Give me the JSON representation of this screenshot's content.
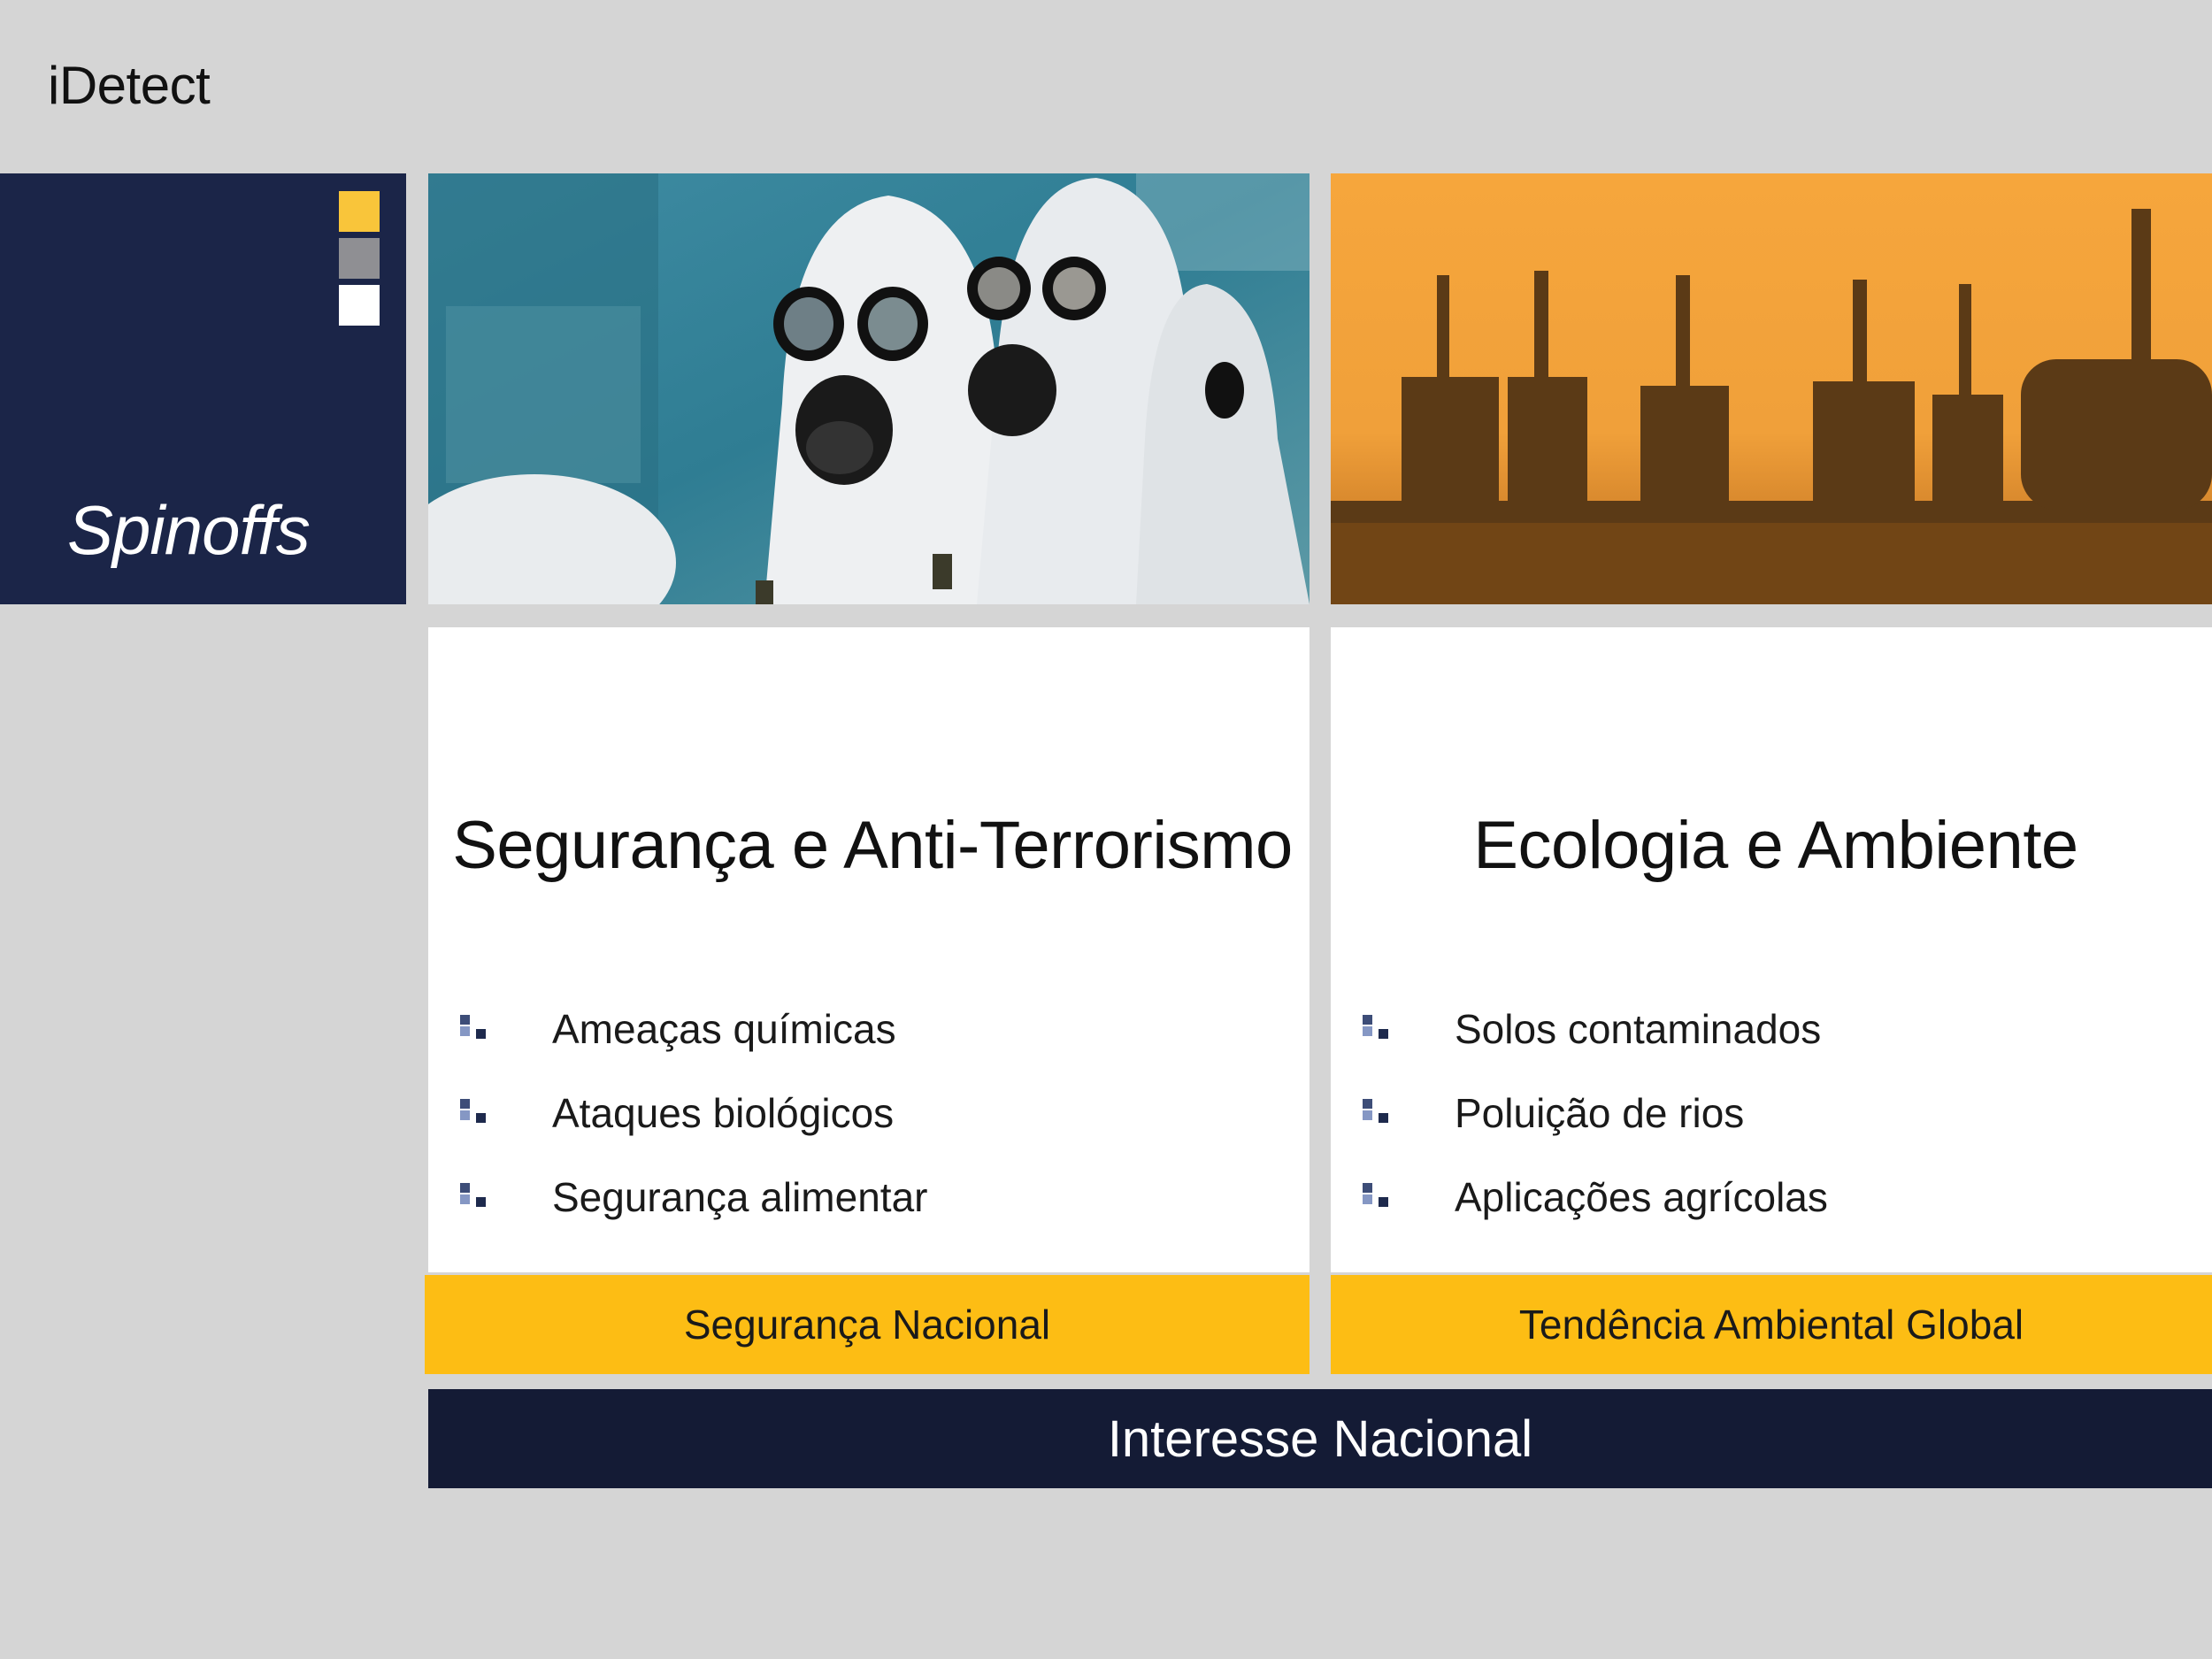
{
  "app": {
    "title": "iDetect"
  },
  "section": {
    "label": "Spinoffs"
  },
  "cards": [
    {
      "title": "Segurança e Anti-Terrorismo",
      "bullets": [
        "Ameaças químicas",
        "Ataques biológicos",
        "Segurança alimentar"
      ],
      "footer": "Segurança Nacional",
      "image": "hazmat-suits-gas-masks-photo"
    },
    {
      "title": "Ecologia e Ambiente",
      "bullets": [
        "Solos contaminados",
        "Poluição de rios",
        "Aplicações agrícolas"
      ],
      "footer": "Tendência Ambiental Global",
      "image": "refinery-sunset-photo"
    }
  ],
  "banner": {
    "label": "Interesse Nacional"
  },
  "colors": {
    "navy": "#1b2548",
    "dark_navy": "#141b35",
    "yellow": "#fdbd14",
    "background": "#d5d5d5"
  }
}
